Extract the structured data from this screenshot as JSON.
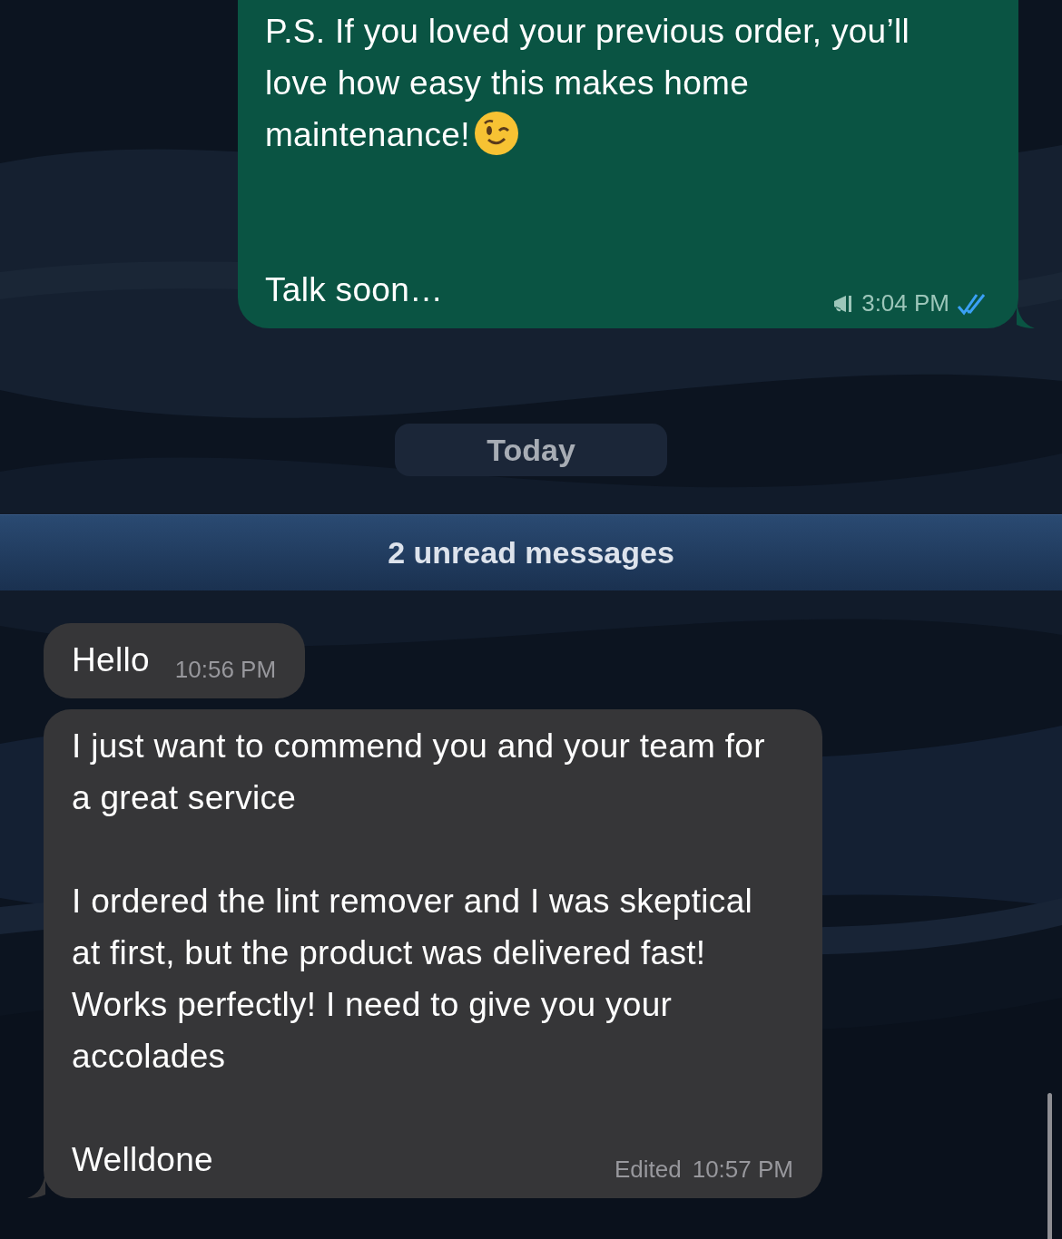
{
  "items": [
    {
      "kind": "outgoing_message",
      "paragraphs": [
        "P.S. If you loved your previous order, you’ll love how easy this makes home maintenance!",
        "Talk soon…"
      ],
      "emoji_after_first": true,
      "broadcast": true,
      "time": "3:04 PM",
      "read": true,
      "tail": true
    },
    {
      "kind": "date",
      "label": "Today"
    },
    {
      "kind": "unread",
      "label": "2 unread messages"
    },
    {
      "kind": "incoming_message",
      "paragraphs": [
        "Hello"
      ],
      "time": "10:56 PM"
    },
    {
      "kind": "incoming_message",
      "paragraphs": [
        "I just want to commend you and your team for a great service",
        "I ordered the lint remover and I was skeptical at first, but the product was delivered fast! Works perfectly! I need to give you your accolades",
        "Welldone"
      ],
      "edited": "Edited",
      "time": "10:57 PM",
      "tail": true
    }
  ]
}
